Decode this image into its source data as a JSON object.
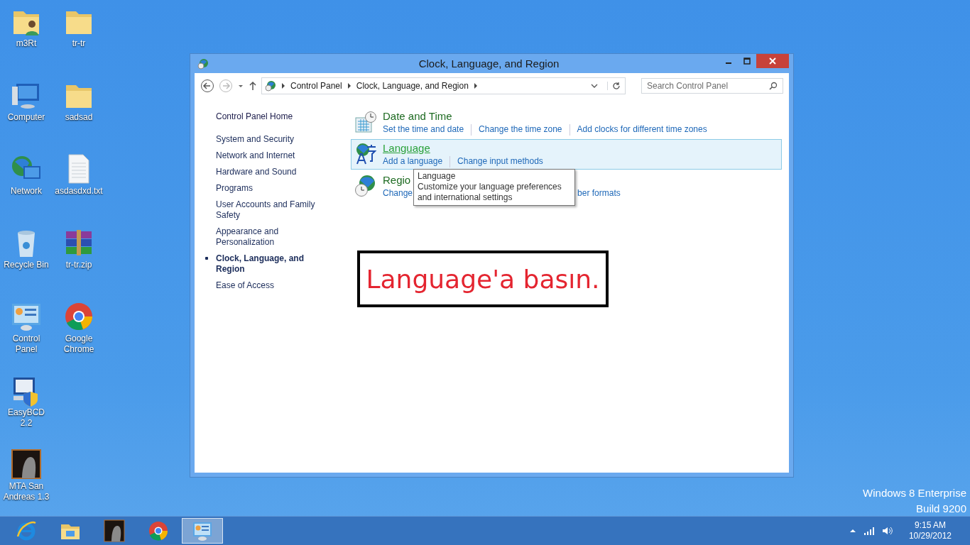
{
  "desktop_icons": [
    {
      "label": "m3Rt",
      "kind": "user-folder"
    },
    {
      "label": "Computer",
      "kind": "computer"
    },
    {
      "label": "Network",
      "kind": "network"
    },
    {
      "label": "Recycle Bin",
      "kind": "recycle"
    },
    {
      "label": "Control Panel",
      "kind": "control-panel"
    },
    {
      "label": "EasyBCD 2.2",
      "kind": "installer"
    },
    {
      "label": "MTA San Andreas 1.3",
      "kind": "game"
    },
    {
      "label": "tr-tr",
      "kind": "folder"
    },
    {
      "label": "sadsad",
      "kind": "folder"
    },
    {
      "label": "asdasdxd.txt",
      "kind": "text-file"
    },
    {
      "label": "tr-tr.zip",
      "kind": "archive"
    },
    {
      "label": "Google Chrome",
      "kind": "chrome"
    }
  ],
  "window": {
    "title": "Clock, Language, and Region",
    "address": {
      "crumbs": [
        "Control Panel",
        "Clock, Language, and Region"
      ]
    },
    "search": {
      "placeholder": "Search Control Panel"
    },
    "sidebar": {
      "home": "Control Panel Home",
      "items": [
        {
          "label": "System and Security",
          "selected": false
        },
        {
          "label": "Network and Internet",
          "selected": false
        },
        {
          "label": "Hardware and Sound",
          "selected": false
        },
        {
          "label": "Programs",
          "selected": false
        },
        {
          "label": "User Accounts and Family Safety",
          "selected": false
        },
        {
          "label": "Appearance and Personalization",
          "selected": false
        },
        {
          "label": "Clock, Language, and Region",
          "selected": true
        },
        {
          "label": "Ease of Access",
          "selected": false
        }
      ]
    },
    "categories": [
      {
        "kind": "clock",
        "title": "Date and Time",
        "hovered": false,
        "links": [
          "Set the time and date",
          "Change the time zone",
          "Add clocks for different time zones"
        ]
      },
      {
        "kind": "language",
        "title": "Language",
        "hovered": true,
        "links": [
          "Add a language",
          "Change input methods"
        ]
      },
      {
        "kind": "region",
        "title": "Regio",
        "hovered": false,
        "links": [
          "Change",
          "ber formats"
        ]
      }
    ],
    "tooltip": {
      "title": "Language",
      "text": "Customize your language preferences and international settings"
    }
  },
  "annotation": "Language'a basın.",
  "watermark": [
    "Windows 8 Enterprise",
    "Build 9200"
  ],
  "taskbar": {
    "items": [
      {
        "kind": "ie",
        "selected": false
      },
      {
        "kind": "explorer",
        "selected": false
      },
      {
        "kind": "game",
        "selected": false
      },
      {
        "kind": "chrome",
        "selected": false
      },
      {
        "kind": "control-panel",
        "selected": true
      }
    ],
    "clock": {
      "time": "9:15 AM",
      "date": "10/29/2012"
    }
  }
}
